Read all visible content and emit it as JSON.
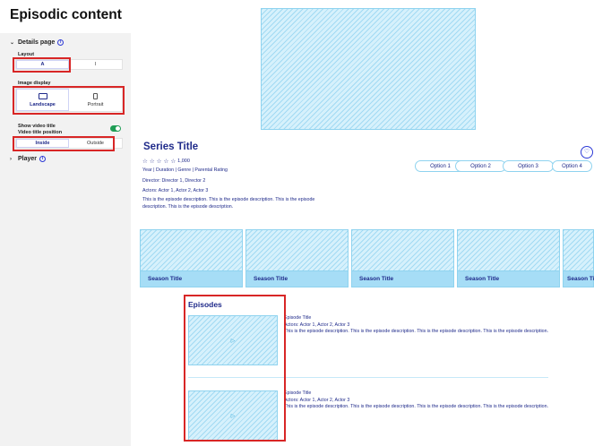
{
  "sidebar": {
    "title": "Episodic content",
    "details_section": "Details page",
    "layout_label": "Layout",
    "layout_options": [
      "A",
      "I"
    ],
    "image_display_label": "Image display",
    "image_display_options": [
      "Landscape",
      "Portrait"
    ],
    "show_video_title_label": "Show video title",
    "show_video_title_enabled": true,
    "video_title_position_label": "Video title position",
    "video_title_position_options": [
      "Inside",
      "Outside"
    ],
    "player_section": "Player"
  },
  "details": {
    "series_title": "Series Title",
    "rating_count": "1,000",
    "meta_line": "Year | Duration | Genre | Parental Rating",
    "director_line": "Director: Director 1, Director 2",
    "actors_line": "Actors: Actor 1, Actor 2, Actor 3",
    "description": "This is the episode description. This is the episode description. This is the episode description. This is the episode description.",
    "options": [
      "Option 1",
      "Option 2",
      "Option 3",
      "Option 4"
    ]
  },
  "seasons": [
    "Season Title",
    "Season Title",
    "Season Title",
    "Season Title",
    "Season Title"
  ],
  "episodes": {
    "title": "Episodes",
    "items": [
      {
        "title": "Episode Title",
        "actors": "Actors: Actor 1, Actor 2, Actor 3",
        "description": "This is the episode description. This is the episode description. This is the episode description. This is the episode description."
      },
      {
        "title": "Episode Title",
        "actors": "Actors: Actor 1, Actor 2, Actor 3",
        "description": "This is the episode description. This is the episode description. This is the episode description. This is the episode description."
      }
    ]
  },
  "colors": {
    "accent": "#1f2a8a",
    "highlight": "#d82626",
    "toggle_on": "#1f9d55",
    "placeholder": "#d6f1fc"
  }
}
